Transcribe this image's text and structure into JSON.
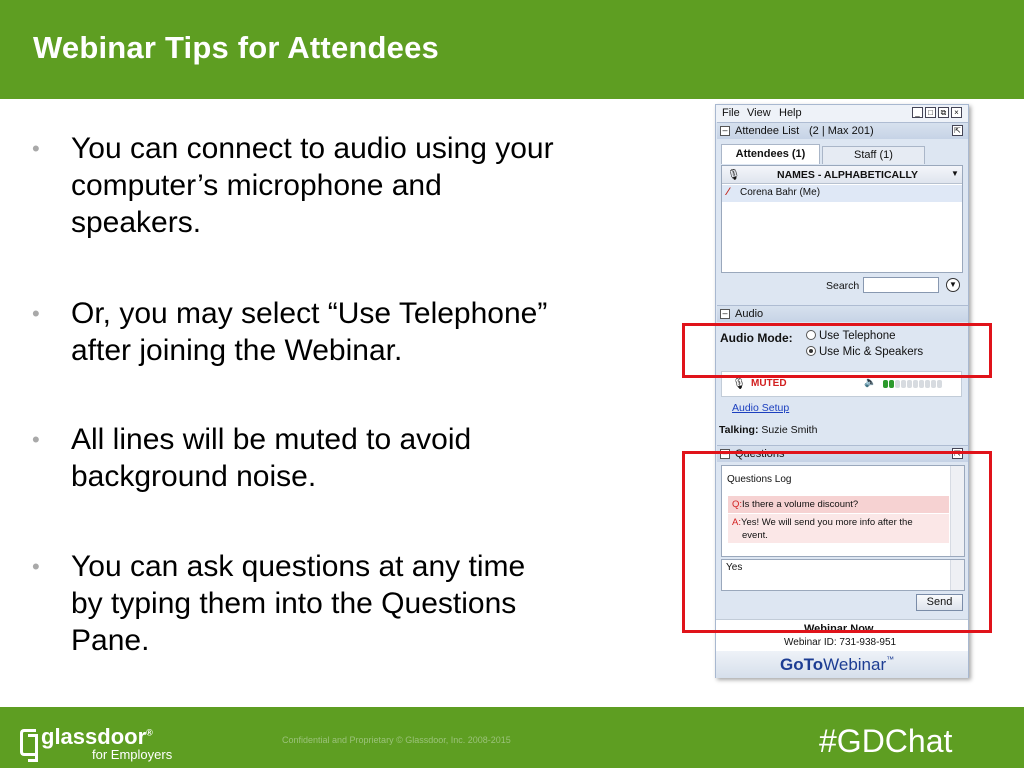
{
  "slide": {
    "title": "Webinar Tips for Attendees",
    "bullet_char": "•",
    "bullets": [
      [
        "You can connect to audio using your",
        "computer’s microphone and",
        "speakers."
      ],
      [
        "Or, you may select “Use Telephone”",
        "after joining the Webinar."
      ],
      [
        "All lines will be muted to avoid",
        "background noise."
      ],
      [
        "You can ask questions at any time",
        "by typing them into the Questions",
        "Pane."
      ]
    ]
  },
  "panel": {
    "menu": [
      "File",
      "View",
      "Help"
    ],
    "attendee_list_label": "Attendee List",
    "attendee_count": "(2 | Max 201)",
    "tabs": [
      "Attendees (1)",
      "Staff (1)"
    ],
    "column_header": "NAMES - ALPHABETICALLY",
    "attendee": "Corena Bahr (Me)",
    "search_label": "Search",
    "audio_label": "Audio",
    "audio_mode_label": "Audio Mode:",
    "audio_options": [
      "Use Telephone",
      "Use Mic & Speakers"
    ],
    "audio_selected": "Use Mic & Speakers",
    "muted_label": "MUTED",
    "audio_setup": "Audio Setup",
    "talking_label": "Talking:",
    "talking_name": "Suzie Smith",
    "questions_label": "Questions",
    "questions_log": "Questions Log",
    "question_prefix": "Q:",
    "question": "Is there a volume discount?",
    "answer_prefix": "A:",
    "answer": [
      "Yes! We will send you more info after the",
      "event."
    ],
    "answer_input": "Yes",
    "send": "Send",
    "webinar_now": "Webinar Now",
    "webinar_id": "Webinar ID: 731-938-951",
    "brand_goto": "GoTo",
    "brand_webinar": "Webinar",
    "brand_tm": "™"
  },
  "footer": {
    "logo_word": "glassdoor",
    "logo_reg": "®",
    "logo_sub": "for Employers",
    "confidential": "Confidential  and  Proprietary © Glassdoor,  Inc.  2008-2015",
    "hashtag": "#GDChat"
  },
  "colors": {
    "brand_green": "#5e9e22",
    "highlight_red": "#e0131a",
    "muted_red": "#d22020",
    "link_blue": "#1b3fbf"
  }
}
